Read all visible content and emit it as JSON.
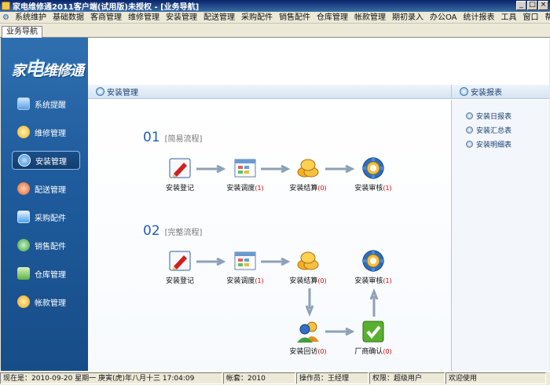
{
  "window": {
    "title": "家电维修通2011客户端(试用版)未授权 - [业务导航]"
  },
  "menu": [
    "系统维护",
    "基础数据",
    "客商管理",
    "维修管理",
    "安装管理",
    "配送管理",
    "采购配件",
    "销售配件",
    "仓库管理",
    "帐款管理",
    "期初录入",
    "办公OA",
    "统计报表",
    "工具",
    "窗口",
    "帮助"
  ],
  "tab": {
    "label": "业务导航"
  },
  "logo": {
    "pre": "家",
    "big": "电",
    "post": "维修通"
  },
  "sidebar": {
    "items": [
      {
        "label": "系统提醒",
        "icon": "monitor-icon",
        "color": "#5aa0e0"
      },
      {
        "label": "维修管理",
        "icon": "gear-icon",
        "color": "#e8b020"
      },
      {
        "label": "安装管理",
        "icon": "globe-icon",
        "color": "#2c86d8"
      },
      {
        "label": "配送管理",
        "icon": "delivery-icon",
        "color": "#e06030"
      },
      {
        "label": "采购配件",
        "icon": "document-icon",
        "color": "#4aa0e8"
      },
      {
        "label": "销售配件",
        "icon": "sales-icon",
        "color": "#3aa040"
      },
      {
        "label": "仓库管理",
        "icon": "warehouse-icon",
        "color": "#60b040"
      },
      {
        "label": "帐款管理",
        "icon": "coins-icon",
        "color": "#e8a020"
      }
    ]
  },
  "content": {
    "title": "安装管理",
    "flow1": {
      "num": "01",
      "label": "[简易流程]"
    },
    "flow2": {
      "num": "02",
      "label": "[完整流程]"
    },
    "nodes": {
      "register": {
        "label": "安装登记"
      },
      "dispatch": {
        "label": "安装调度",
        "count": "(1)"
      },
      "settle": {
        "label": "安装结算",
        "count": "(0)"
      },
      "audit": {
        "label": "安装审核",
        "count": "(1)"
      },
      "visit": {
        "label": "安装回访",
        "count": "(0)"
      },
      "confirm": {
        "label": "厂商确认",
        "count": "(0)"
      }
    }
  },
  "reports": {
    "title": "安装报表",
    "items": [
      "安装日报表",
      "安装汇总表",
      "安装明细表"
    ]
  },
  "status": {
    "now": "现在是：2010-09-20 星期一 庚寅(虎)年八月十三 17:04:09",
    "account": "帐套：2010",
    "operator": "操作员：王经理",
    "permission": "权限：超级用户",
    "welcome": "欢迎使用"
  }
}
